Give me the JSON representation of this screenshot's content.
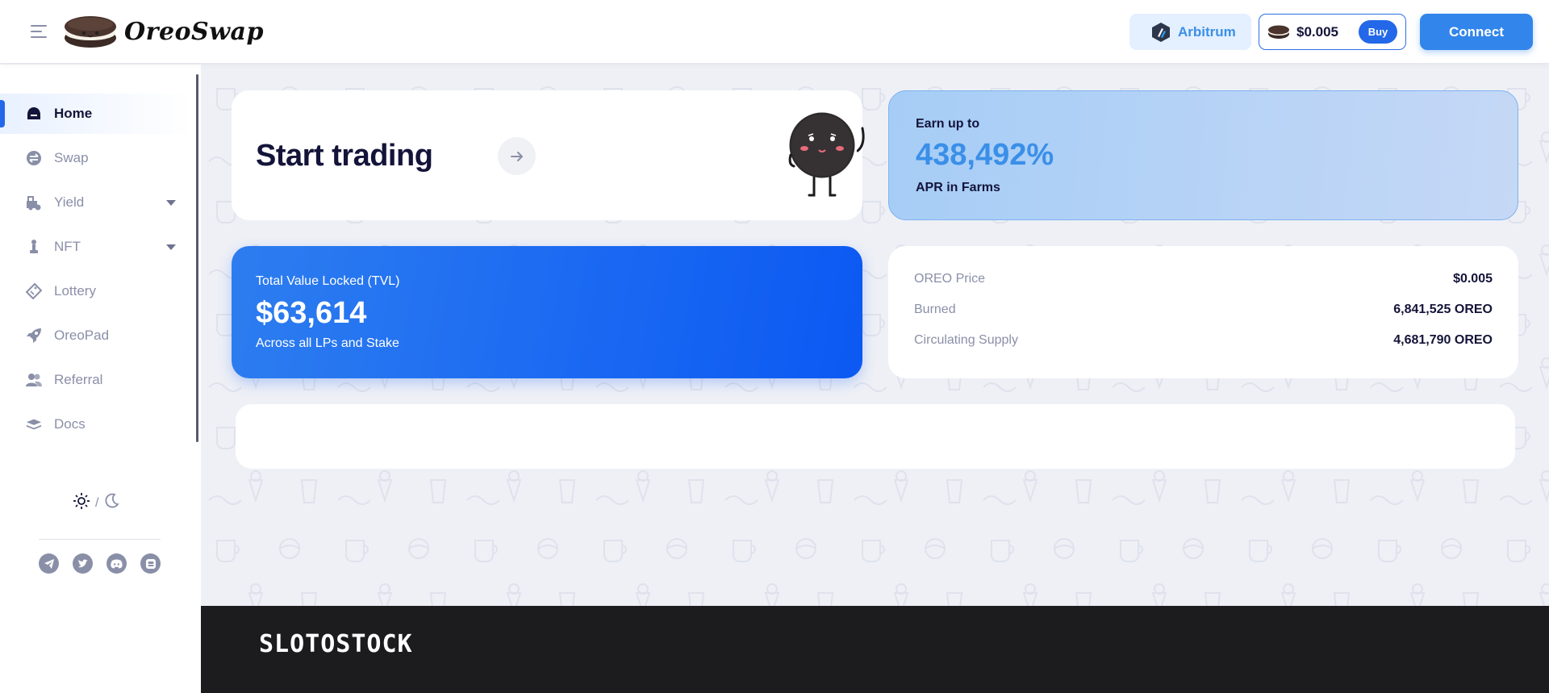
{
  "header": {
    "brand": "OreoSwap",
    "chain_label": "Arbitrum",
    "token_price": "$0.005",
    "buy_label": "Buy",
    "connect_label": "Connect"
  },
  "sidebar": {
    "items": [
      {
        "label": "Home",
        "icon": "home-icon",
        "active": true
      },
      {
        "label": "Swap",
        "icon": "swap-icon"
      },
      {
        "label": "Yield",
        "icon": "yield-icon",
        "expandable": true
      },
      {
        "label": "NFT",
        "icon": "nft-icon",
        "expandable": true
      },
      {
        "label": "Lottery",
        "icon": "ticket-icon"
      },
      {
        "label": "OreoPad",
        "icon": "rocket-icon"
      },
      {
        "label": "Referral",
        "icon": "users-icon"
      },
      {
        "label": "Docs",
        "icon": "book-icon"
      }
    ],
    "theme_separator": "/",
    "socials": [
      "telegram-icon",
      "twitter-icon",
      "discord-icon",
      "medium-icon"
    ]
  },
  "main": {
    "trade_title": "Start trading",
    "earn": {
      "subtitle": "Earn up to",
      "value": "438,492%",
      "footer": "APR in Farms"
    },
    "tvl": {
      "label": "Total Value Locked (TVL)",
      "value": "$63,614",
      "footer": "Across all LPs and Stake"
    },
    "stats": [
      {
        "label": "OREO Price",
        "value": "$0.005"
      },
      {
        "label": "Burned",
        "value": "6,841,525 OREO"
      },
      {
        "label": "Circulating Supply",
        "value": "4,681,790 OREO"
      }
    ]
  },
  "footer": {
    "watermark": "SLOTOSTOCK"
  },
  "colors": {
    "accent": "#2268e8",
    "primary_text": "#14143a",
    "muted_text": "#8a8fa8",
    "earn_value": "#3a8fe8"
  }
}
